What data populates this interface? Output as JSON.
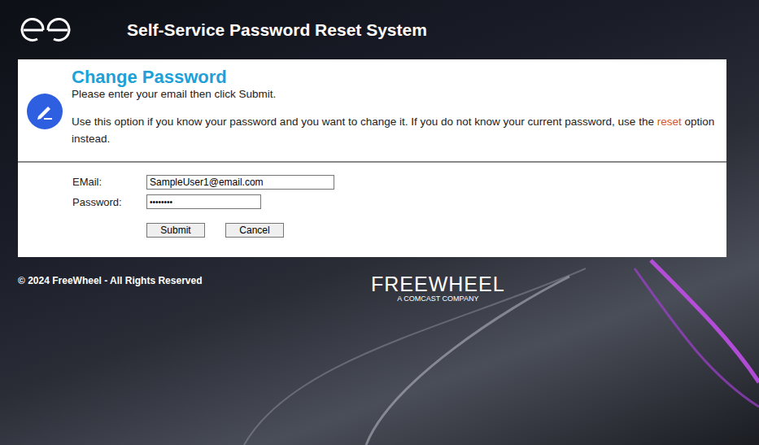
{
  "header": {
    "title": "Self-Service Password Reset System"
  },
  "panel": {
    "title": "Change Password",
    "instruction": "Please enter your email then click Submit.",
    "description_before": "Use this option if you know your password and you want to change it. If you do not know your current password, use the ",
    "description_link": "reset",
    "description_after": " option instead."
  },
  "form": {
    "fields": [
      {
        "label": "EMail:",
        "value": "SampleUser1@email.com"
      },
      {
        "label": "Password:",
        "value": "••••••••"
      }
    ],
    "buttons": [
      "Submit",
      "Cancel"
    ]
  },
  "footer": {
    "copyright": "© 2024 FreeWheel - All Rights Reserved",
    "brand": "FREEWHEEL",
    "brand_tagline": "A COMCAST COMPANY"
  }
}
